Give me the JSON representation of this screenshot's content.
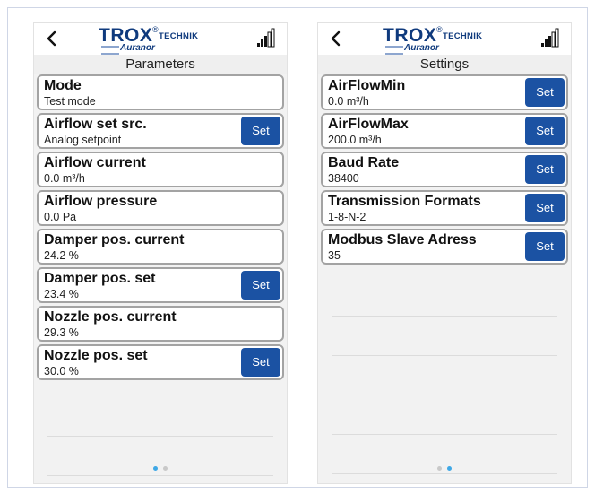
{
  "colors": {
    "brand": "#0f3a7d",
    "button": "#1b52a3",
    "page_dot_active": "#3fa8e6"
  },
  "screens": [
    {
      "title": "Parameters",
      "logo": {
        "brand": "TROX",
        "registered": "®",
        "suffix": "TECHNIK",
        "subbrand": "Auranor"
      },
      "icons": {
        "back": "chevron-left-icon",
        "signal": "signal-strength-icon"
      },
      "items": [
        {
          "label": "Mode",
          "value": "Test mode",
          "has_set": false
        },
        {
          "label": "Airflow set src.",
          "value": "Analog setpoint",
          "has_set": true,
          "button": "Set"
        },
        {
          "label": "Airflow current",
          "value": "0.0 m³/h",
          "has_set": false
        },
        {
          "label": "Airflow pressure",
          "value": "0.0 Pa",
          "has_set": false
        },
        {
          "label": "Damper pos. current",
          "value": "24.2 %",
          "has_set": false
        },
        {
          "label": "Damper pos. set",
          "value": "23.4 %",
          "has_set": true,
          "button": "Set"
        },
        {
          "label": "Nozzle pos. current",
          "value": "29.3 %",
          "has_set": false
        },
        {
          "label": "Nozzle pos. set",
          "value": "30.0 %",
          "has_set": true,
          "button": "Set"
        }
      ],
      "page_indicator": {
        "pages": 2,
        "active": 1
      }
    },
    {
      "title": "Settings",
      "logo": {
        "brand": "TROX",
        "registered": "®",
        "suffix": "TECHNIK",
        "subbrand": "Auranor"
      },
      "icons": {
        "back": "chevron-left-icon",
        "signal": "signal-strength-icon"
      },
      "items": [
        {
          "label": "AirFlowMin",
          "value": "0.0 m³/h",
          "has_set": true,
          "button": "Set"
        },
        {
          "label": "AirFlowMax",
          "value": "200.0 m³/h",
          "has_set": true,
          "button": "Set"
        },
        {
          "label": "Baud Rate",
          "value": "38400",
          "has_set": true,
          "button": "Set"
        },
        {
          "label": "Transmission Formats",
          "value": "1-8-N-2",
          "has_set": true,
          "button": "Set"
        },
        {
          "label": "Modbus Slave Adress",
          "value": "35",
          "has_set": true,
          "button": "Set"
        }
      ],
      "page_indicator": {
        "pages": 2,
        "active": 2
      }
    }
  ]
}
